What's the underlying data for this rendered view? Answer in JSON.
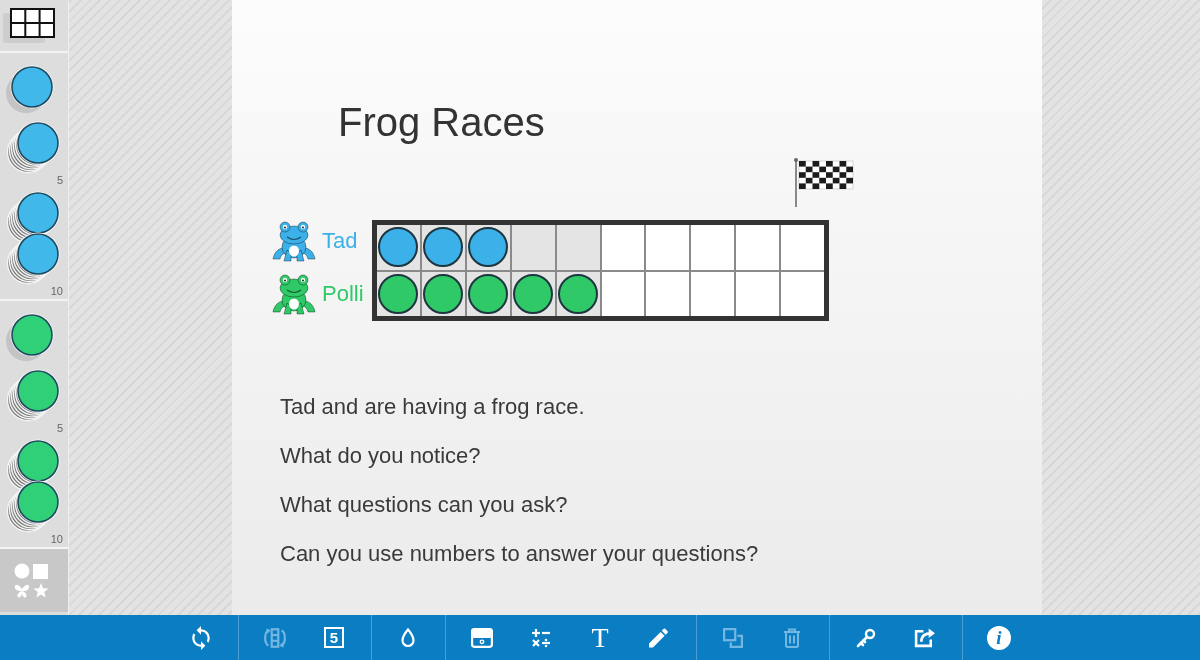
{
  "sidebar": {
    "sections": [
      {
        "kind": "grid"
      },
      {
        "kind": "counters",
        "color": "#41b8ea",
        "items": [
          {
            "kind": "single"
          },
          {
            "kind": "stack",
            "count": "5"
          },
          {
            "kind": "double-stack",
            "count": "10"
          }
        ]
      },
      {
        "kind": "counters",
        "color": "#2fd078",
        "items": [
          {
            "kind": "single"
          },
          {
            "kind": "stack",
            "count": "5"
          },
          {
            "kind": "double-stack",
            "count": "10"
          }
        ]
      },
      {
        "kind": "shapes"
      }
    ]
  },
  "canvas": {
    "title": "Frog Races",
    "racers": [
      {
        "name": "Tad",
        "color": "#3cb0e8",
        "cells": [
          {
            "shaded": true,
            "counter": true
          },
          {
            "shaded": true,
            "counter": true
          },
          {
            "shaded": true,
            "counter": true
          },
          {
            "shaded": true,
            "counter": false
          },
          {
            "shaded": true,
            "counter": false
          },
          {
            "shaded": false,
            "counter": false
          },
          {
            "shaded": false,
            "counter": false
          },
          {
            "shaded": false,
            "counter": false
          },
          {
            "shaded": false,
            "counter": false
          },
          {
            "shaded": false,
            "counter": false
          }
        ]
      },
      {
        "name": "Polli",
        "color": "#2fc968",
        "cells": [
          {
            "shaded": true,
            "counter": true
          },
          {
            "shaded": true,
            "counter": true
          },
          {
            "shaded": true,
            "counter": true
          },
          {
            "shaded": true,
            "counter": true
          },
          {
            "shaded": true,
            "counter": true
          },
          {
            "shaded": false,
            "counter": false
          },
          {
            "shaded": false,
            "counter": false
          },
          {
            "shaded": false,
            "counter": false
          },
          {
            "shaded": false,
            "counter": false
          },
          {
            "shaded": false,
            "counter": false
          }
        ]
      }
    ],
    "prompts": [
      "Tad and are having a frog race.",
      "What do you notice?",
      "What questions can you ask?",
      "Can you use numbers to answer your questions?"
    ]
  },
  "toolbar": {
    "groups": [
      [
        {
          "kind": "refresh",
          "disabled": false
        }
      ],
      [
        {
          "kind": "flip",
          "disabled": true
        },
        {
          "kind": "number-frame",
          "label": "5",
          "disabled": false
        }
      ],
      [
        {
          "kind": "color",
          "disabled": false
        }
      ],
      [
        {
          "kind": "frame",
          "disabled": false
        },
        {
          "kind": "operations",
          "disabled": false
        },
        {
          "kind": "text",
          "label": "T",
          "disabled": false
        },
        {
          "kind": "pencil",
          "disabled": false
        }
      ],
      [
        {
          "kind": "duplicate",
          "disabled": true
        },
        {
          "kind": "trash",
          "disabled": true
        }
      ],
      [
        {
          "kind": "key",
          "disabled": false
        },
        {
          "kind": "share",
          "disabled": false
        }
      ],
      [
        {
          "kind": "info",
          "label": "i",
          "disabled": false
        }
      ]
    ]
  }
}
